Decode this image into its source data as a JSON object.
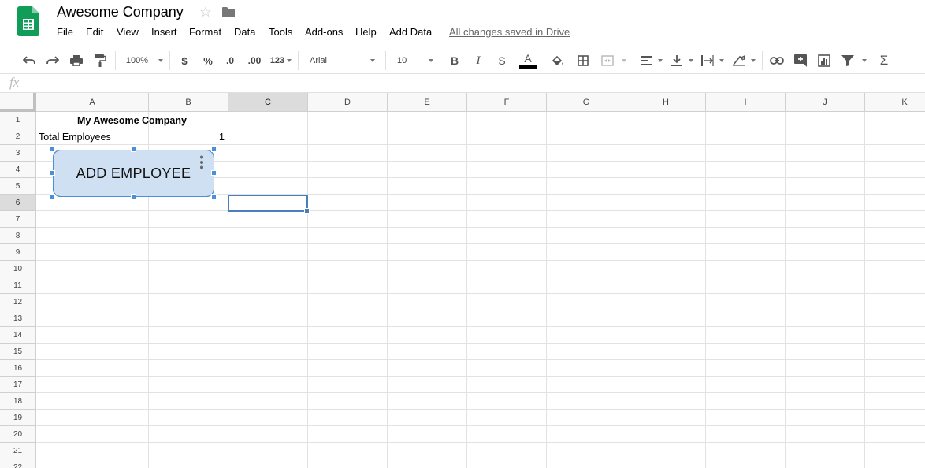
{
  "app": {
    "title": "Awesome Company",
    "save_status": "All changes saved in Drive",
    "menu": [
      "File",
      "Edit",
      "View",
      "Insert",
      "Format",
      "Data",
      "Tools",
      "Add-ons",
      "Help",
      "Add Data"
    ]
  },
  "toolbar": {
    "zoom": "100%",
    "currency": "$",
    "percent": "%",
    "dec_decrease": ".0",
    "dec_increase": ".00",
    "number_format": "123",
    "font": "Arial",
    "font_size": "10",
    "text_color": "#000000"
  },
  "formula_bar": {
    "label": "fx",
    "value": ""
  },
  "sheet": {
    "columns": [
      "A",
      "B",
      "C",
      "D",
      "E",
      "F",
      "G",
      "H",
      "I",
      "J",
      "K"
    ],
    "selected_column": "C",
    "rows": [
      "1",
      "2",
      "3",
      "4",
      "5",
      "6",
      "7",
      "8",
      "9",
      "10",
      "11",
      "12",
      "13",
      "14",
      "15",
      "16",
      "17",
      "18",
      "19",
      "20",
      "21",
      "22"
    ],
    "selected_row": "6",
    "cells": {
      "A1": "My Awesome Company",
      "A2": "Total Employees",
      "B2": "1"
    }
  },
  "drawing": {
    "label": "ADD EMPLOYEE",
    "fill_color": "#cfe0f3"
  },
  "colors": {
    "sheets_green": "#0f9d58",
    "selection_blue": "#4a7fbd"
  }
}
